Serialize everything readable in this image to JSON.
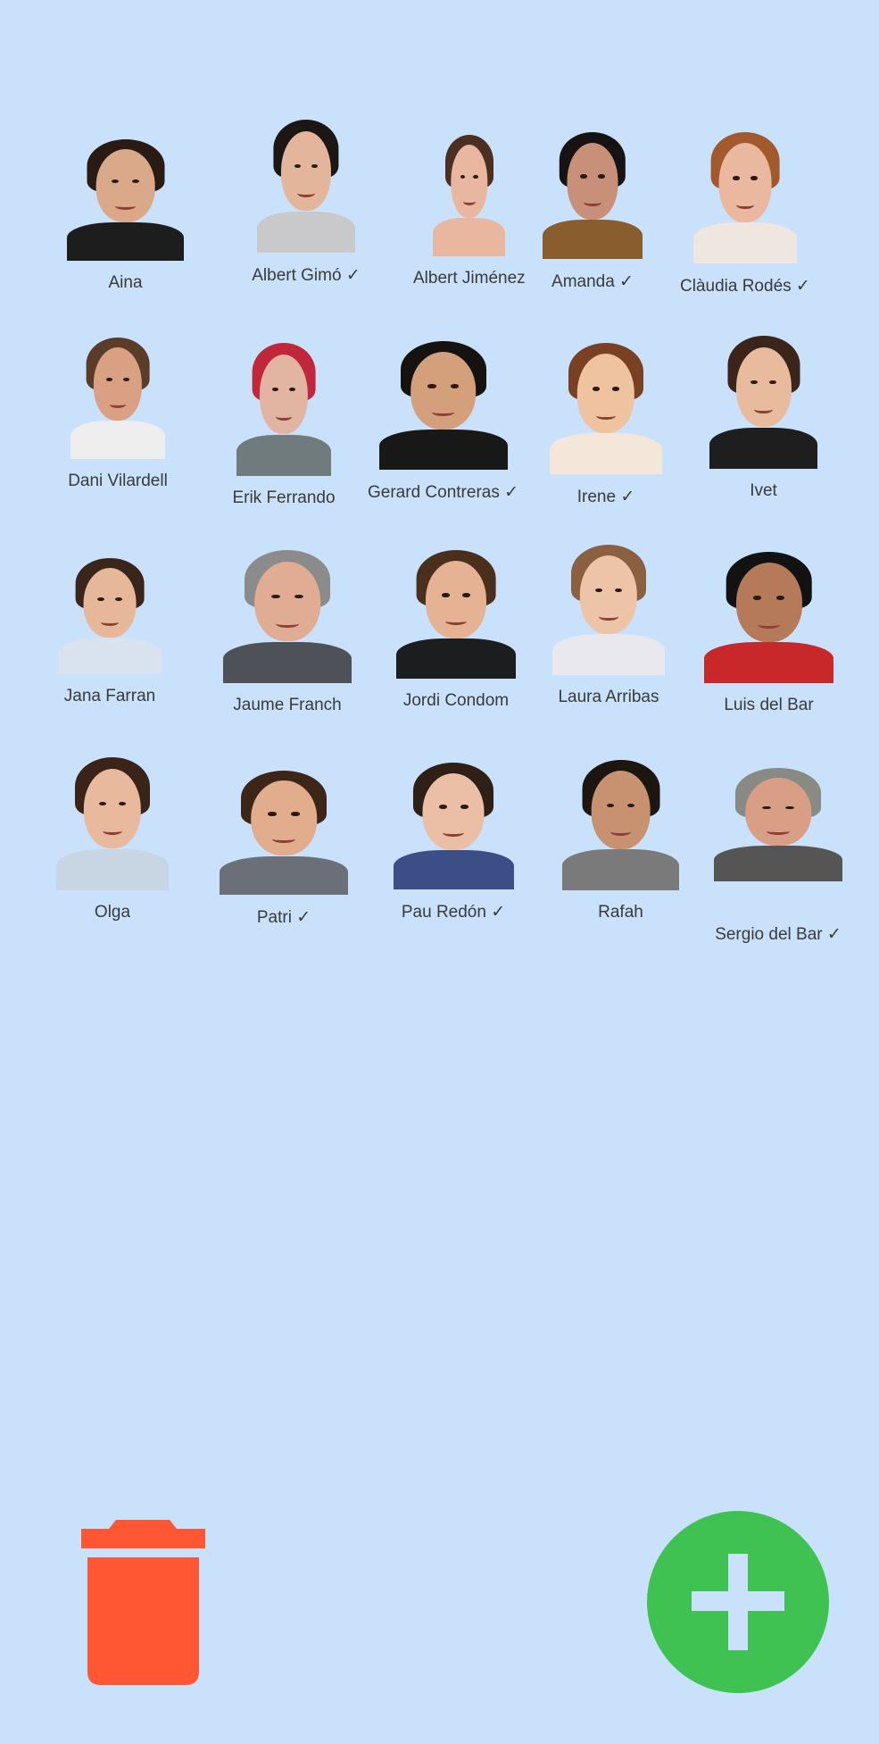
{
  "people": [
    {
      "name": "Aina"
    },
    {
      "name": "Albert Gimó ✓"
    },
    {
      "name": "Albert Jiménez"
    },
    {
      "name": "Amanda ✓"
    },
    {
      "name": "Clàudia Rodés ✓"
    },
    {
      "name": "Dani Vilardell"
    },
    {
      "name": "Erik Ferrando"
    },
    {
      "name": "Gerard Contreras ✓"
    },
    {
      "name": "Irene ✓"
    },
    {
      "name": "Ivet"
    },
    {
      "name": "Jana Farran"
    },
    {
      "name": "Jaume Franch"
    },
    {
      "name": "Jordi Condom"
    },
    {
      "name": "Laura Arribas"
    },
    {
      "name": "Luis del Bar"
    },
    {
      "name": "Olga"
    },
    {
      "name": "Patri ✓"
    },
    {
      "name": "Pau Redón ✓"
    },
    {
      "name": "Rafah"
    },
    {
      "name": "Sergio del Bar ✓"
    }
  ],
  "actions": {
    "delete_icon": "trash-icon",
    "add_icon": "plus-icon"
  },
  "colors": {
    "background": "#c9e1fb",
    "delete": "#ff5733",
    "add": "#3fc251"
  }
}
